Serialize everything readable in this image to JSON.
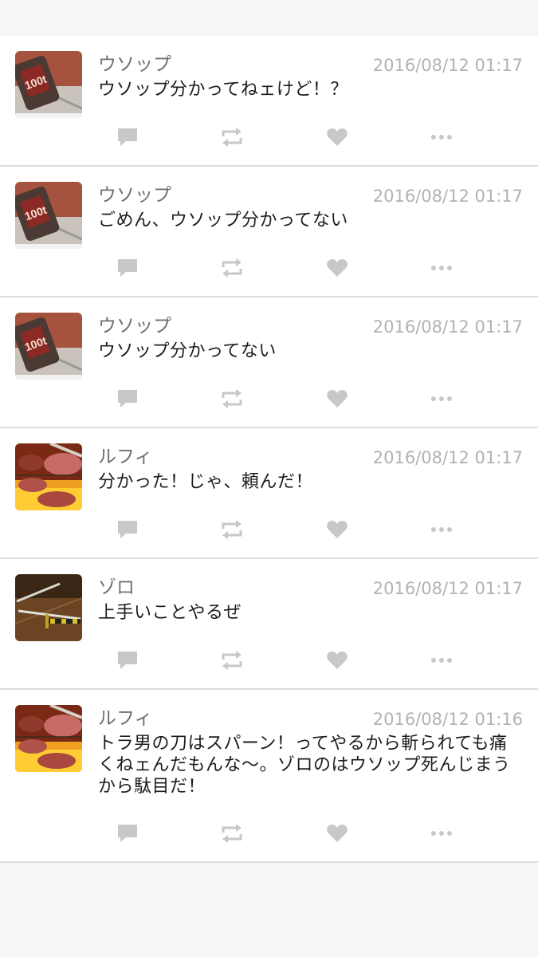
{
  "posts": [
    {
      "avatar": "hammer-avatar",
      "name": "ウソップ",
      "time": "2016/08/12 01:17",
      "text": "ウソップ分かってねェけど！？"
    },
    {
      "avatar": "hammer-avatar",
      "name": "ウソップ",
      "time": "2016/08/12 01:17",
      "text": "ごめん、ウソップ分かってない"
    },
    {
      "avatar": "hammer-avatar",
      "name": "ウソップ",
      "time": "2016/08/12 01:17",
      "text": "ウソップ分かってない"
    },
    {
      "avatar": "grilled-meat-avatar",
      "name": "ルフィ",
      "time": "2016/08/12 01:17",
      "text": "分かった！じゃ、頼んだ！"
    },
    {
      "avatar": "swords-avatar",
      "name": "ゾロ",
      "time": "2016/08/12 01:17",
      "text": "上手いことやるぜ"
    },
    {
      "avatar": "grilled-meat-avatar",
      "name": "ルフィ",
      "time": "2016/08/12 01:16",
      "text": "トラ男の刀はスパーン！ってやるから斬られても痛くねェんだもんな〜。ゾロのはウソップ死んじまうから駄目だ！"
    }
  ],
  "action_icons": [
    "reply-icon",
    "retweet-icon",
    "like-icon",
    "more-icon"
  ],
  "colors": {
    "icon": "#c8c8c8",
    "name": "#707070",
    "time": "#b2b2b2",
    "text": "#1d1d1d",
    "divider": "#dcdcdc",
    "background": "#f6f6f6"
  }
}
